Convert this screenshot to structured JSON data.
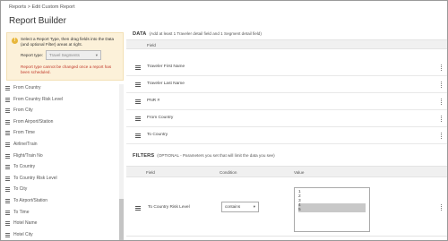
{
  "breadcrumb": {
    "root": "Reports",
    "separator": ">",
    "current": "Edit Custom Report"
  },
  "page": {
    "title": "Report Builder"
  },
  "sidebar": {
    "hint": "Select a Report Type, then drag fields into the Data (and optional Filter) areas at right.",
    "report_type_label": "Report type:",
    "report_type_value": "Travel Segments",
    "warning": "Report type cannot be changed once a report has been scheduled.",
    "fields": [
      "From Country",
      "From Country Risk Level",
      "From City",
      "From Airport/Station",
      "From Time",
      "Airline/Train",
      "Flight/Train No",
      "To Country",
      "To Country Risk Level",
      "To City",
      "To Airport/Station",
      "To Time",
      "Hotel Name",
      "Hotel City"
    ]
  },
  "data_section": {
    "title": "DATA",
    "note": "(Add at least 1 Traveler detail field and 1 Segment detail field)",
    "column_header": "Field",
    "rows": [
      "Traveler First Name",
      "Traveler Last Name",
      "PNR #",
      "From Country",
      "To Country"
    ]
  },
  "filters_section": {
    "title": "FILTERS",
    "note": "(OPTIONAL - Parameters you set that will limit the data you see)",
    "columns": {
      "field": "Field",
      "condition": "Condition",
      "value": "Value"
    },
    "row": {
      "field": "To Country Risk Level",
      "condition": "contains",
      "values": [
        "1",
        "2",
        "3",
        "4",
        "5"
      ],
      "selected_values": [
        "4",
        "5"
      ]
    }
  },
  "icons": {
    "hint": "info-icon",
    "drag": "drag-handle-icon",
    "menu": "more-vertical-icon",
    "dropdown": "chevron-down-icon"
  },
  "colors": {
    "hint_background": "#fcf1d9",
    "warning_text": "#c0392b",
    "selected_value": "#c8c8c8"
  }
}
